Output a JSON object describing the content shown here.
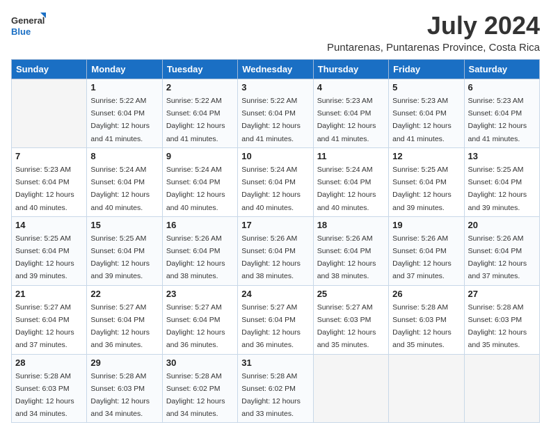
{
  "logo": {
    "line1": "General",
    "line2": "Blue"
  },
  "title": "July 2024",
  "location": "Puntarenas, Puntarenas Province, Costa Rica",
  "weekdays": [
    "Sunday",
    "Monday",
    "Tuesday",
    "Wednesday",
    "Thursday",
    "Friday",
    "Saturday"
  ],
  "weeks": [
    [
      {
        "day": null
      },
      {
        "day": 1,
        "sunrise": "5:22 AM",
        "sunset": "6:04 PM",
        "daylight": "12 hours and 41 minutes."
      },
      {
        "day": 2,
        "sunrise": "5:22 AM",
        "sunset": "6:04 PM",
        "daylight": "12 hours and 41 minutes."
      },
      {
        "day": 3,
        "sunrise": "5:22 AM",
        "sunset": "6:04 PM",
        "daylight": "12 hours and 41 minutes."
      },
      {
        "day": 4,
        "sunrise": "5:23 AM",
        "sunset": "6:04 PM",
        "daylight": "12 hours and 41 minutes."
      },
      {
        "day": 5,
        "sunrise": "5:23 AM",
        "sunset": "6:04 PM",
        "daylight": "12 hours and 41 minutes."
      },
      {
        "day": 6,
        "sunrise": "5:23 AM",
        "sunset": "6:04 PM",
        "daylight": "12 hours and 41 minutes."
      }
    ],
    [
      {
        "day": 7,
        "sunrise": "5:23 AM",
        "sunset": "6:04 PM",
        "daylight": "12 hours and 40 minutes."
      },
      {
        "day": 8,
        "sunrise": "5:24 AM",
        "sunset": "6:04 PM",
        "daylight": "12 hours and 40 minutes."
      },
      {
        "day": 9,
        "sunrise": "5:24 AM",
        "sunset": "6:04 PM",
        "daylight": "12 hours and 40 minutes."
      },
      {
        "day": 10,
        "sunrise": "5:24 AM",
        "sunset": "6:04 PM",
        "daylight": "12 hours and 40 minutes."
      },
      {
        "day": 11,
        "sunrise": "5:24 AM",
        "sunset": "6:04 PM",
        "daylight": "12 hours and 40 minutes."
      },
      {
        "day": 12,
        "sunrise": "5:25 AM",
        "sunset": "6:04 PM",
        "daylight": "12 hours and 39 minutes."
      },
      {
        "day": 13,
        "sunrise": "5:25 AM",
        "sunset": "6:04 PM",
        "daylight": "12 hours and 39 minutes."
      }
    ],
    [
      {
        "day": 14,
        "sunrise": "5:25 AM",
        "sunset": "6:04 PM",
        "daylight": "12 hours and 39 minutes."
      },
      {
        "day": 15,
        "sunrise": "5:25 AM",
        "sunset": "6:04 PM",
        "daylight": "12 hours and 39 minutes."
      },
      {
        "day": 16,
        "sunrise": "5:26 AM",
        "sunset": "6:04 PM",
        "daylight": "12 hours and 38 minutes."
      },
      {
        "day": 17,
        "sunrise": "5:26 AM",
        "sunset": "6:04 PM",
        "daylight": "12 hours and 38 minutes."
      },
      {
        "day": 18,
        "sunrise": "5:26 AM",
        "sunset": "6:04 PM",
        "daylight": "12 hours and 38 minutes."
      },
      {
        "day": 19,
        "sunrise": "5:26 AM",
        "sunset": "6:04 PM",
        "daylight": "12 hours and 37 minutes."
      },
      {
        "day": 20,
        "sunrise": "5:26 AM",
        "sunset": "6:04 PM",
        "daylight": "12 hours and 37 minutes."
      }
    ],
    [
      {
        "day": 21,
        "sunrise": "5:27 AM",
        "sunset": "6:04 PM",
        "daylight": "12 hours and 37 minutes."
      },
      {
        "day": 22,
        "sunrise": "5:27 AM",
        "sunset": "6:04 PM",
        "daylight": "12 hours and 36 minutes."
      },
      {
        "day": 23,
        "sunrise": "5:27 AM",
        "sunset": "6:04 PM",
        "daylight": "12 hours and 36 minutes."
      },
      {
        "day": 24,
        "sunrise": "5:27 AM",
        "sunset": "6:04 PM",
        "daylight": "12 hours and 36 minutes."
      },
      {
        "day": 25,
        "sunrise": "5:27 AM",
        "sunset": "6:03 PM",
        "daylight": "12 hours and 35 minutes."
      },
      {
        "day": 26,
        "sunrise": "5:28 AM",
        "sunset": "6:03 PM",
        "daylight": "12 hours and 35 minutes."
      },
      {
        "day": 27,
        "sunrise": "5:28 AM",
        "sunset": "6:03 PM",
        "daylight": "12 hours and 35 minutes."
      }
    ],
    [
      {
        "day": 28,
        "sunrise": "5:28 AM",
        "sunset": "6:03 PM",
        "daylight": "12 hours and 34 minutes."
      },
      {
        "day": 29,
        "sunrise": "5:28 AM",
        "sunset": "6:03 PM",
        "daylight": "12 hours and 34 minutes."
      },
      {
        "day": 30,
        "sunrise": "5:28 AM",
        "sunset": "6:02 PM",
        "daylight": "12 hours and 34 minutes."
      },
      {
        "day": 31,
        "sunrise": "5:28 AM",
        "sunset": "6:02 PM",
        "daylight": "12 hours and 33 minutes."
      },
      {
        "day": null
      },
      {
        "day": null
      },
      {
        "day": null
      }
    ]
  ]
}
